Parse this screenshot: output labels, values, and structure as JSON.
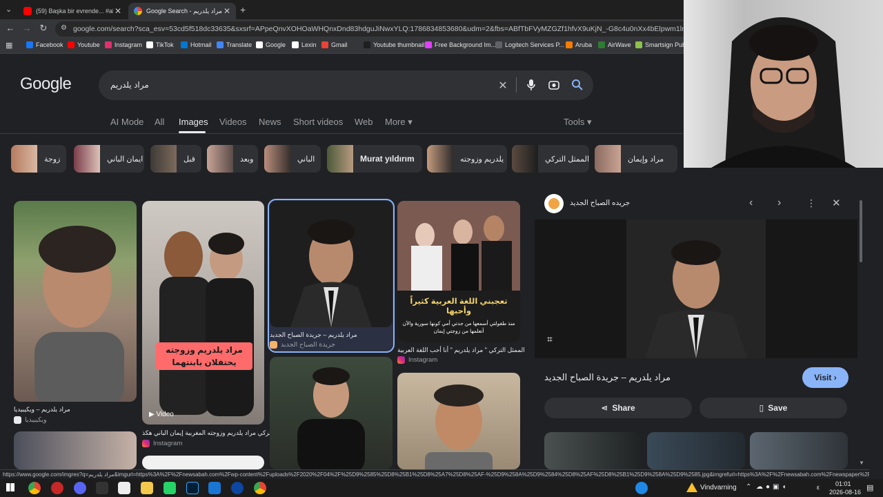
{
  "browser": {
    "tabs": [
      {
        "title": "(59) Başka bir evrende... #akım"
      },
      {
        "title": "Google Search - مراد يلدريم"
      }
    ],
    "new_tab": "+",
    "url": "google.com/search?sca_esv=53cd5f518dc33635&sxsrf=APpeQnvXOHOaWHQnxDnd83hdguJiNwxYLQ:1786834853680&udm=2&fbs=ABfTbFVyMZGZf1hfvX9uKjN_-G8c4u0nXx4bElpwm1lnNH832VTJOOCxW_fyN-Q_e",
    "bookmarks": [
      {
        "label": "Facebook",
        "color": "#1877f2"
      },
      {
        "label": "Youtube",
        "color": "#ff0000"
      },
      {
        "label": "Instagram",
        "color": "#e1306c"
      },
      {
        "label": "TikTok",
        "color": "#ffffff"
      },
      {
        "label": "Hotmail",
        "color": "#0078d4"
      },
      {
        "label": "Translate",
        "color": "#4285f4"
      },
      {
        "label": "Google",
        "color": "#ffffff"
      },
      {
        "label": "Lexin",
        "color": "#ffffff"
      },
      {
        "label": "Gmail",
        "color": "#ea4335"
      },
      {
        "label": "Youtube thumbnail l...",
        "color": "#1f1f1f"
      },
      {
        "label": "Free Background Im...",
        "color": "#e040fb"
      },
      {
        "label": "Logitech Services P...",
        "color": "#5f6368"
      },
      {
        "label": "Aruba",
        "color": "#f57c00"
      },
      {
        "label": "AirWave",
        "color": "#2e7d32"
      },
      {
        "label": "Smartsign Publ",
        "color": "#8bc34a"
      }
    ]
  },
  "google": {
    "logo": "Google",
    "query": "مراد يلدريم",
    "nav_tabs": [
      "AI Mode",
      "All",
      "Images",
      "Videos",
      "News",
      "Short videos",
      "Web",
      "More ▾"
    ],
    "tools": "Tools ▾",
    "chips": [
      "زوجة",
      "ايمان الباني",
      "قبل",
      "وبعد",
      "الباني",
      "Murat yıldırım",
      "يلدريم وزوجته",
      "الممثل التركي",
      "مراد وإيمان"
    ]
  },
  "results": [
    {
      "caption": "مراد يلدريم – ويكيبيديا",
      "source": "ويكيبيديا"
    },
    {
      "overlay": "مراد يلدريم وزوجته يحتفلان بابنتهما",
      "video_label": "Video",
      "caption": "التركي مراد يلدريم وزوجته المغربية إيمان الباني هكذ..",
      "source": "Instagram"
    },
    {
      "caption": "مراد يلدريم – جريدة الصباح الجديد",
      "source": "جريدة الصباح الجديد"
    },
    {
      "overlay1": "تعجبني اللغة العربية كثيراً وأحبها",
      "overlay2": "منذ طفولتي أسمعها من جدتي أمي كونها سورية والآن أتعلمها من زوجتي إيمان",
      "caption": "الممثل التركي \" مراد يلدريم \" أنا أحب اللغة العربية",
      "source": "Instagram"
    }
  ],
  "panel": {
    "source_name": "جريده الصباح الجديد",
    "title": "مراد يلدريم – جريدة الصباح الجديد",
    "visit": "Visit ›",
    "share": "Share",
    "save": "Save"
  },
  "status_url": "https://www.google.com/imgres?q=مراد يلدريم&imgurl=https%3A%2F%2Fnewsabah.com%2Fwp-content%2Fuploads%2F2020%2F04%2F%25D9%2585%25D8%25B1%25D8%25A7%25D8%25AF-%25D9%258A%25D9%2584%25D8%25AF%25D8%25B1%25D9%258A%25D9%2585.jpg&imgrefurl=https%3A%2F%2Fnewsabah.com%2Fnewspaper%2F236066...",
  "taskbar": {
    "weather": "Vindvarning",
    "lang": "ε",
    "time": "01:01",
    "date": "2026-08-16"
  }
}
